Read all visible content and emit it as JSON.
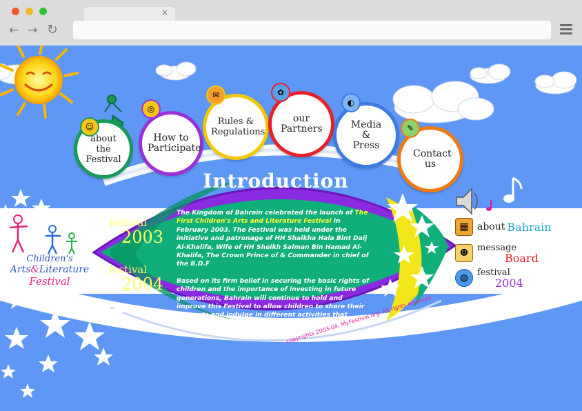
{
  "browser": {
    "tab_close": "×",
    "back": "←",
    "forward": "→",
    "reload": "↻"
  },
  "nav": {
    "about": "about the Festival",
    "participate": "How to Participate",
    "rules": "Rules & Regulations",
    "partners": "our Partners",
    "media": "Media & Press",
    "contact": "Contact us"
  },
  "logo": {
    "line1": "Children's",
    "line2a": "Arts",
    "amp": "&",
    "line2b": "Literature",
    "line3": "Festival"
  },
  "intro": {
    "heading": "Introduction",
    "p1_a": "The Kingdom of Bahrain celebrated the launch of ",
    "p1_hl": "The First Children's Arts and Literature Festival",
    "p1_b": " in February 2003. The Festival was held under the initiative and patronage of HH Shaikha Hala Bint Daij Al-Khalifa, Wife of HH Sheikh Salman Bin Hamad Al-Khalifa, The Crown Prince of & Commander in chief of the B.D.F",
    "p2": "Based on its firm belief in securing the basic rights of children and the importance of investing in future generations, Bahrain will continue to hold and improve this Festival to allow children to share their interests and indulge in different activities that inspire their creativity."
  },
  "festivals": {
    "f2003_word": "festival",
    "f2003_year": "2003",
    "f2004_word": "festival",
    "f2004_year": "2004"
  },
  "side": {
    "about_a": "about",
    "about_b": "Bahrain",
    "msg_a": "message",
    "msg_b": "Board",
    "fest_a": "festival",
    "fest_b": "2004"
  },
  "footer": {
    "copyright": "copyrights 2003-04, MyFestival.org. All rights reserved."
  },
  "colors": {
    "sky": "#5f97f7",
    "green_panel": "#0fae7a",
    "purple": "#8a2be2",
    "about_ring": "#169a5a",
    "participate_ring": "#9b30d9",
    "rules_ring": "#f2c90a",
    "partners_ring": "#e8202a",
    "media_ring": "#3d7be3",
    "contact_ring": "#f07a12"
  },
  "icons": [
    "sun-icon",
    "cloud-icon",
    "smiley-icon",
    "ring-icon",
    "bag-icon",
    "globe-icon",
    "speaker-icon",
    "music-note-icon",
    "window-icon",
    "people-icon"
  ]
}
